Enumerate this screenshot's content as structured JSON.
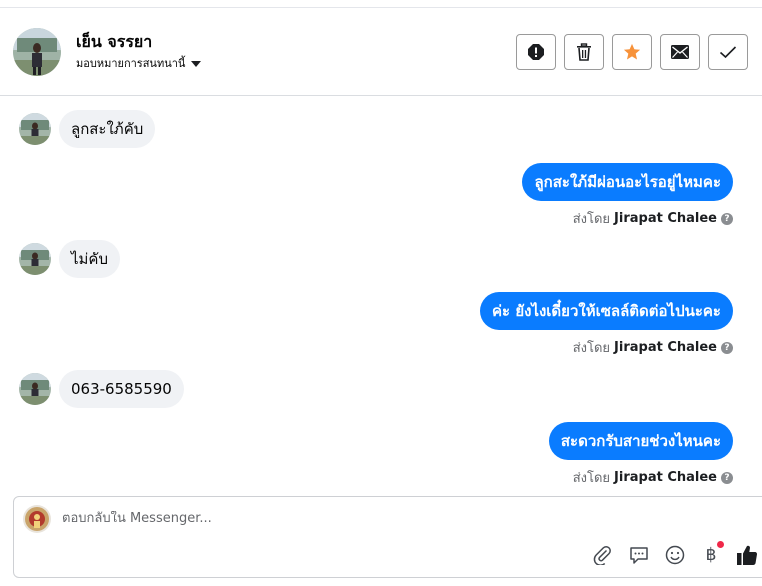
{
  "header": {
    "name": "เย็น จรรยา",
    "assign_label": "มอบหมายการสนทนานี้",
    "actions": [
      {
        "icon": "alert-icon",
        "label": "spam"
      },
      {
        "icon": "trash-icon",
        "label": "delete"
      },
      {
        "icon": "star-icon",
        "label": "follow-up"
      },
      {
        "icon": "envelope-icon",
        "label": "mark-unread"
      },
      {
        "icon": "check-icon",
        "label": "done"
      }
    ]
  },
  "messages": [
    {
      "dir": "in",
      "text": "ลูกสะใภ้คับ"
    },
    {
      "dir": "out",
      "text": "ลูกสะใภ้มีผ่อนอะไรอยู่ไหมคะ",
      "sent_by_prefix": "ส่งโดย",
      "sent_by_name": "Jirapat Chalee"
    },
    {
      "dir": "in",
      "text": "ไม่คับ"
    },
    {
      "dir": "out",
      "text": "ค่ะ ยังไงเดี๋ยวให้เซลล์ติดต่อไปนะคะ",
      "sent_by_prefix": "ส่งโดย",
      "sent_by_name": "Jirapat Chalee"
    },
    {
      "dir": "in",
      "text": "063-6585590"
    },
    {
      "dir": "out",
      "text": "สะดวกรับสายช่วงไหนคะ",
      "sent_by_prefix": "ส่งโดย",
      "sent_by_name": "Jirapat Chalee"
    }
  ],
  "composer": {
    "placeholder": "ตอบกลับใน Messenger...",
    "tools": [
      "paperclip-icon",
      "chat-bubble-icon",
      "smiley-icon",
      "baht-icon",
      "thumbs-up-icon"
    ],
    "baht_symbol": "฿"
  },
  "colors": {
    "bubble_out": "#0a7cff",
    "bubble_in": "#f0f2f5",
    "star": "#f7923a",
    "notification_dot": "#f02849"
  }
}
